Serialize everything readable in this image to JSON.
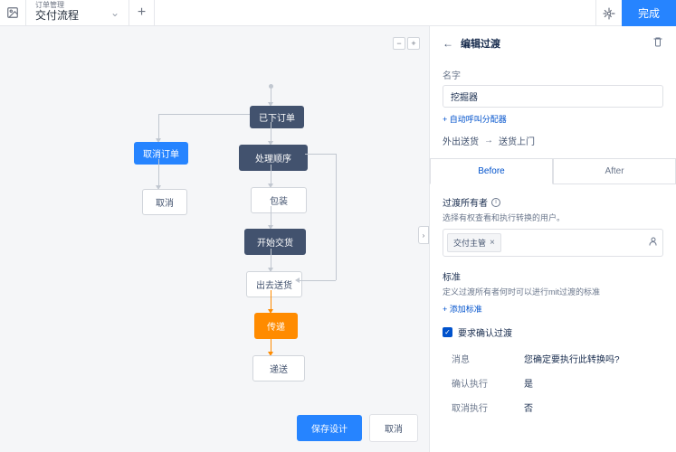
{
  "header": {
    "project_sub": "订单管理",
    "project_title": "交付流程",
    "done": "完成"
  },
  "zoom": {
    "minus": "−",
    "plus": "+"
  },
  "nodes": {
    "n1": "已下订单",
    "n2": "处理顺序",
    "n3": "包装",
    "n4": "开始交货",
    "n5": "出去送货",
    "n6": "传递",
    "n7": "递送",
    "n8": "取消订单",
    "n9": "取消"
  },
  "panel": {
    "title": "编辑过渡",
    "name_label": "名字",
    "name_value": "挖掘器",
    "auto_call_link": "+ 自动呼叫分配器",
    "from_state": "外出送货",
    "to_state": "送货上门",
    "tab_before": "Before",
    "tab_after": "After",
    "owner_title": "过渡所有者",
    "owner_desc": "选择有权查看和执行转换的用户。",
    "owner_chip": "交付主管",
    "criteria_title": "标准",
    "criteria_desc": "定义过渡所有者何时可以进行mit过渡的标准",
    "add_criteria_link": "+ 添加标准",
    "require_confirm": "要求确认过渡",
    "kv": [
      {
        "k": "消息",
        "v": "您确定要执行此转换吗?"
      },
      {
        "k": "确认执行",
        "v": "是"
      },
      {
        "k": "取消执行",
        "v": "否"
      }
    ]
  },
  "footer": {
    "save": "保存设计",
    "cancel": "取消"
  }
}
